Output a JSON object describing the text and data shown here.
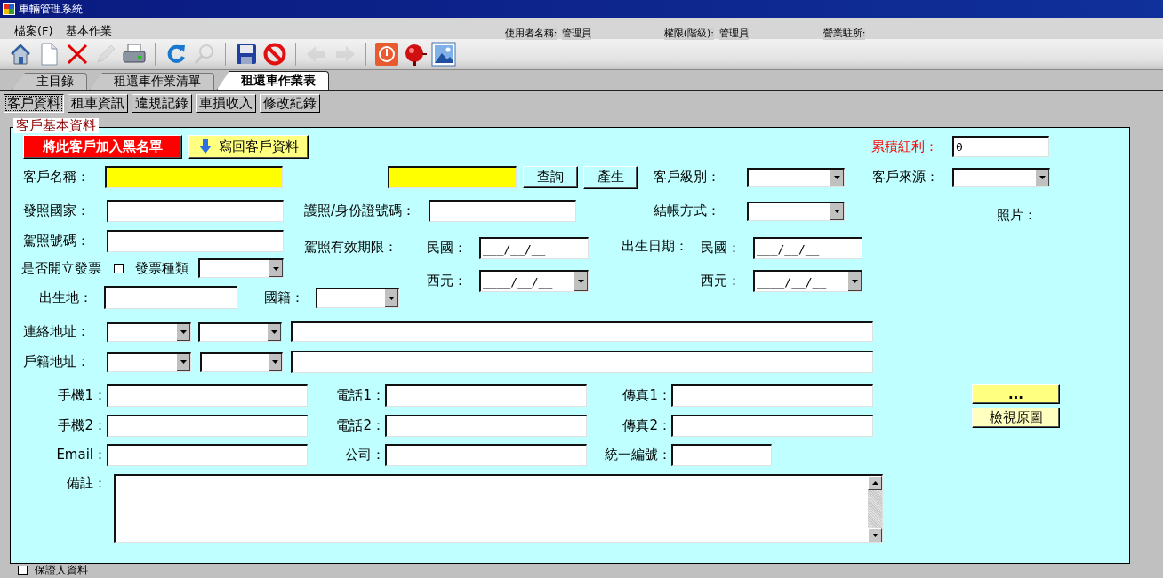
{
  "window": {
    "title": "車輛管理系統"
  },
  "menu": [
    {
      "label": "檔案(F)"
    },
    {
      "label": "基本作業"
    }
  ],
  "user_info": [
    {
      "label": "使用者名稱:",
      "value": "管理員"
    },
    {
      "label": "權限(階級):",
      "value": "管理員"
    },
    {
      "label": "營業駐所:"
    }
  ],
  "toolbar": [
    {
      "disabled": false
    },
    {
      "disabled": false
    },
    {
      "disabled": false
    },
    {
      "disabled": true
    },
    {
      "disabled": false
    },
    {
      "disabled": false
    },
    {
      "disabled": true
    },
    {
      "disabled": false
    },
    {
      "disabled": false
    },
    {
      "disabled": true
    },
    {
      "disabled": true
    },
    {
      "disabled": false
    },
    {
      "disabled": false
    },
    {
      "disabled": false
    }
  ],
  "tabs": [
    {
      "label": "主目錄",
      "selected": false
    },
    {
      "label": "租還車作業清單",
      "selected": false
    },
    {
      "label": "租還車作業表",
      "selected": true
    }
  ],
  "subtabs": [
    {
      "label": "客戶資料",
      "selected": true
    },
    {
      "label": "租車資訊",
      "selected": false
    },
    {
      "label": "違規記錄",
      "selected": false
    },
    {
      "label": "車損收入",
      "selected": false
    },
    {
      "label": "修改紀錄",
      "selected": false
    }
  ],
  "customer": {
    "legend": "客戶基本資料",
    "blacklist_button": "將此客戶加入黑名單",
    "writeback_button": "寫回客戶資料",
    "bonus": {
      "label": "累積紅利：",
      "value": "0"
    },
    "customer_name": {
      "label": "客戶名稱："
    },
    "lookup_button": "查詢",
    "generate_button": "產生",
    "customer_level": {
      "label": "客戶級別："
    },
    "customer_source": {
      "label": "客戶來源："
    },
    "issuing_country": {
      "label": "發照國家："
    },
    "passport_id": {
      "label": "護照/身份證號碼："
    },
    "billing_method": {
      "label": "結帳方式："
    },
    "photo": {
      "label": "照片：",
      "browse_button": "...",
      "view_button": "檢視原圖"
    },
    "license_no": {
      "label": "駕照號碼："
    },
    "license_expiry": {
      "label": "駕照有效期限：",
      "roc_label": "民國：",
      "roc_value": "___/__/__",
      "ad_label": "西元：",
      "ad_value": "____/__/__"
    },
    "birth_date": {
      "label": "出生日期：",
      "roc_label": "民國：",
      "roc_value": "___/__/__",
      "ad_label": "西元：",
      "ad_value": "____/__/__"
    },
    "invoice": {
      "label": "是否開立發票",
      "checked": false,
      "type_label": "發票種類"
    },
    "birthplace": {
      "label": "出生地："
    },
    "nationality": {
      "label": "國籍："
    },
    "contact_address": {
      "label": "連絡地址："
    },
    "registered_address": {
      "label": "戶籍地址："
    },
    "mobile1": {
      "label": "手機1："
    },
    "phone1": {
      "label": "電話1："
    },
    "fax1": {
      "label": "傳真1："
    },
    "mobile2": {
      "label": "手機2："
    },
    "phone2": {
      "label": "電話2："
    },
    "fax2": {
      "label": "傳真2："
    },
    "email": {
      "label": "Email："
    },
    "company": {
      "label": "公司："
    },
    "tax_id": {
      "label": "統一編號："
    },
    "notes": {
      "label": "備註："
    }
  },
  "guarantor": {
    "label": "保證人資料",
    "checked": false
  }
}
